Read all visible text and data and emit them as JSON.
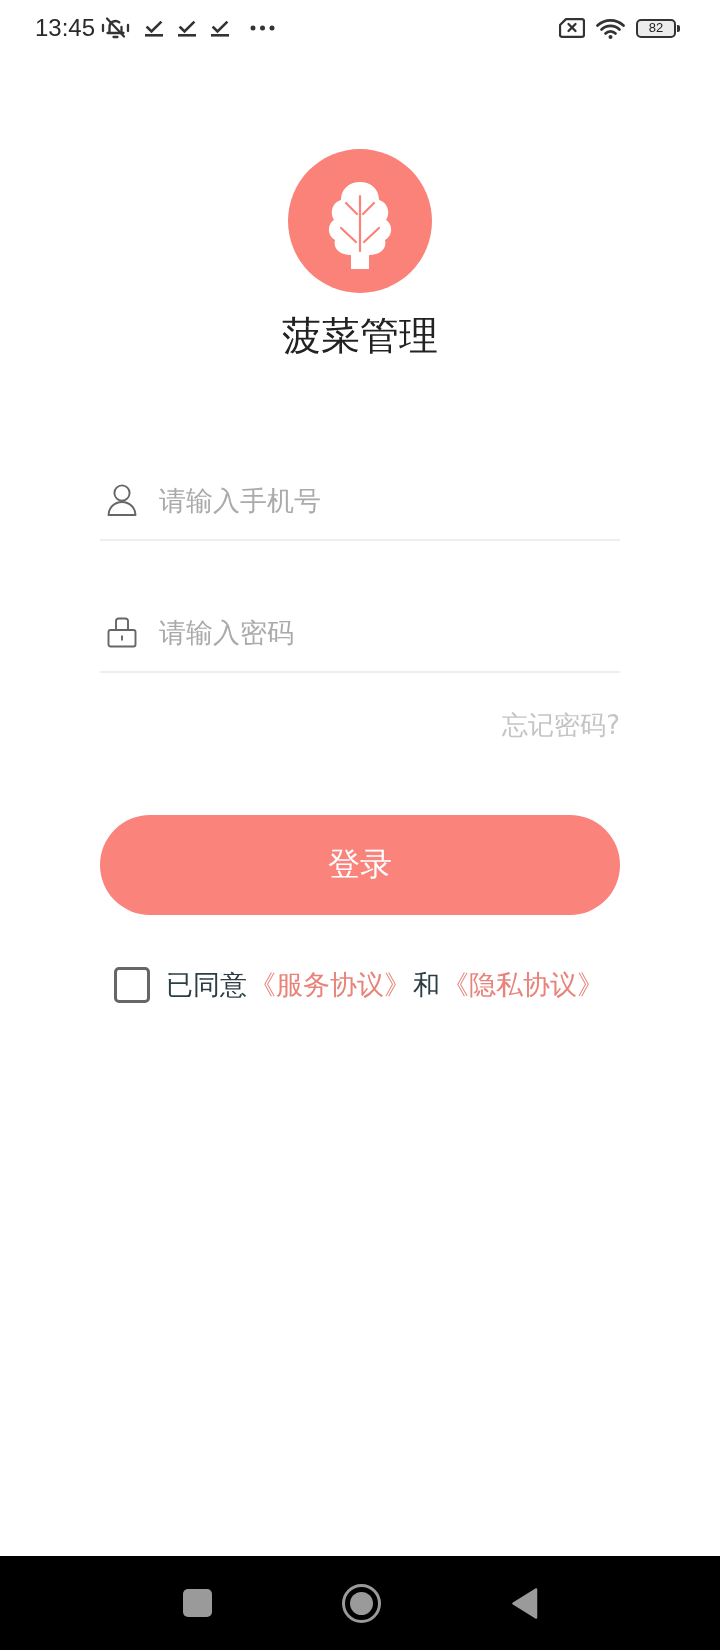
{
  "status_bar": {
    "time": "13:45",
    "battery": "82"
  },
  "app": {
    "title": "菠菜管理"
  },
  "fields": [
    {
      "kind": "phone",
      "placeholder": "请输入手机号"
    },
    {
      "kind": "password",
      "placeholder": "请输入密码"
    }
  ],
  "forgot_password": "忘记密码?",
  "login_button": "登录",
  "agreement": {
    "checked": false,
    "parts": [
      {
        "kind": "text",
        "text": "已同意"
      },
      {
        "kind": "link",
        "text": "《服务协议》"
      },
      {
        "kind": "text",
        "text": "和"
      },
      {
        "kind": "link",
        "text": "《隐私协议》"
      }
    ]
  }
}
